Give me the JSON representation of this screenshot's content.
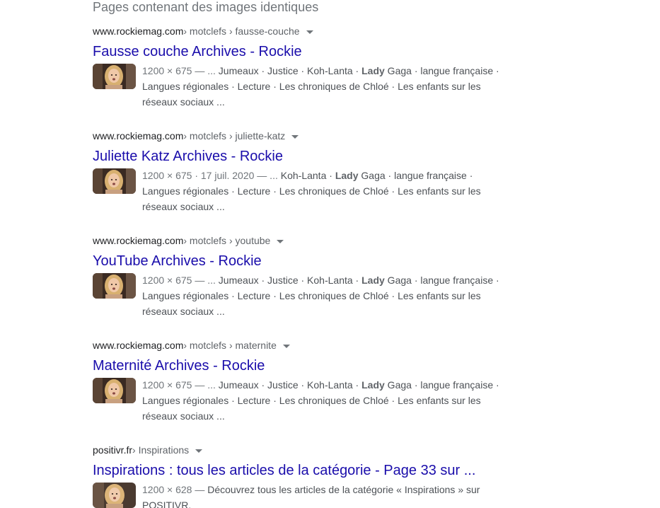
{
  "section": {
    "title": "Pages contenant des images identiques"
  },
  "results": [
    {
      "domain": "www.rockiemag.com",
      "path": " › motclefs › fausse-couche",
      "title": "Fausse couche Archives - Rockie",
      "meta": "1200 × 675 — ... ",
      "before": "Jumeaux · Justice · Koh-Lanta · ",
      "bold": "Lady",
      "after": " Gaga · langue française · Langues régionales · Lecture · Les chroniques de Chloé · Les enfants sur les réseaux sociaux ..."
    },
    {
      "domain": "www.rockiemag.com",
      "path": " › motclefs › juliette-katz",
      "title": "Juliette Katz Archives - Rockie",
      "meta": "1200 × 675 · 17 juil. 2020 — ... ",
      "before": "Koh-Lanta · ",
      "bold": "Lady",
      "after": " Gaga · langue française · Langues régionales · Lecture · Les chroniques de Chloé · Les enfants sur les réseaux sociaux ..."
    },
    {
      "domain": "www.rockiemag.com",
      "path": " › motclefs › youtube",
      "title": "YouTube Archives - Rockie",
      "meta": "1200 × 675 — ... ",
      "before": "Jumeaux · Justice · Koh-Lanta · ",
      "bold": "Lady",
      "after": " Gaga · langue française · Langues régionales · Lecture · Les chroniques de Chloé · Les enfants sur les réseaux sociaux ..."
    },
    {
      "domain": "www.rockiemag.com",
      "path": " › motclefs › maternite",
      "title": "Maternité Archives - Rockie",
      "meta": "1200 × 675 — ... ",
      "before": "Jumeaux · Justice · Koh-Lanta · ",
      "bold": "Lady",
      "after": " Gaga · langue française · Langues régionales · Lecture · Les chroniques de Chloé · Les enfants sur les réseaux sociaux ..."
    },
    {
      "domain": "positivr.fr",
      "path": " › Inspirations",
      "title": "Inspirations : tous les articles de la catégorie - Page 33 sur ...",
      "meta": "1200 × 628 — ",
      "before": "Découvrez tous les articles de la catégorie « Inspirations » sur POSITIVR.",
      "bold": "",
      "after": ""
    }
  ],
  "colors": {
    "link": "#1a0dab",
    "cite": "#202124",
    "snippet": "#4d5156",
    "meta": "#70757a"
  }
}
